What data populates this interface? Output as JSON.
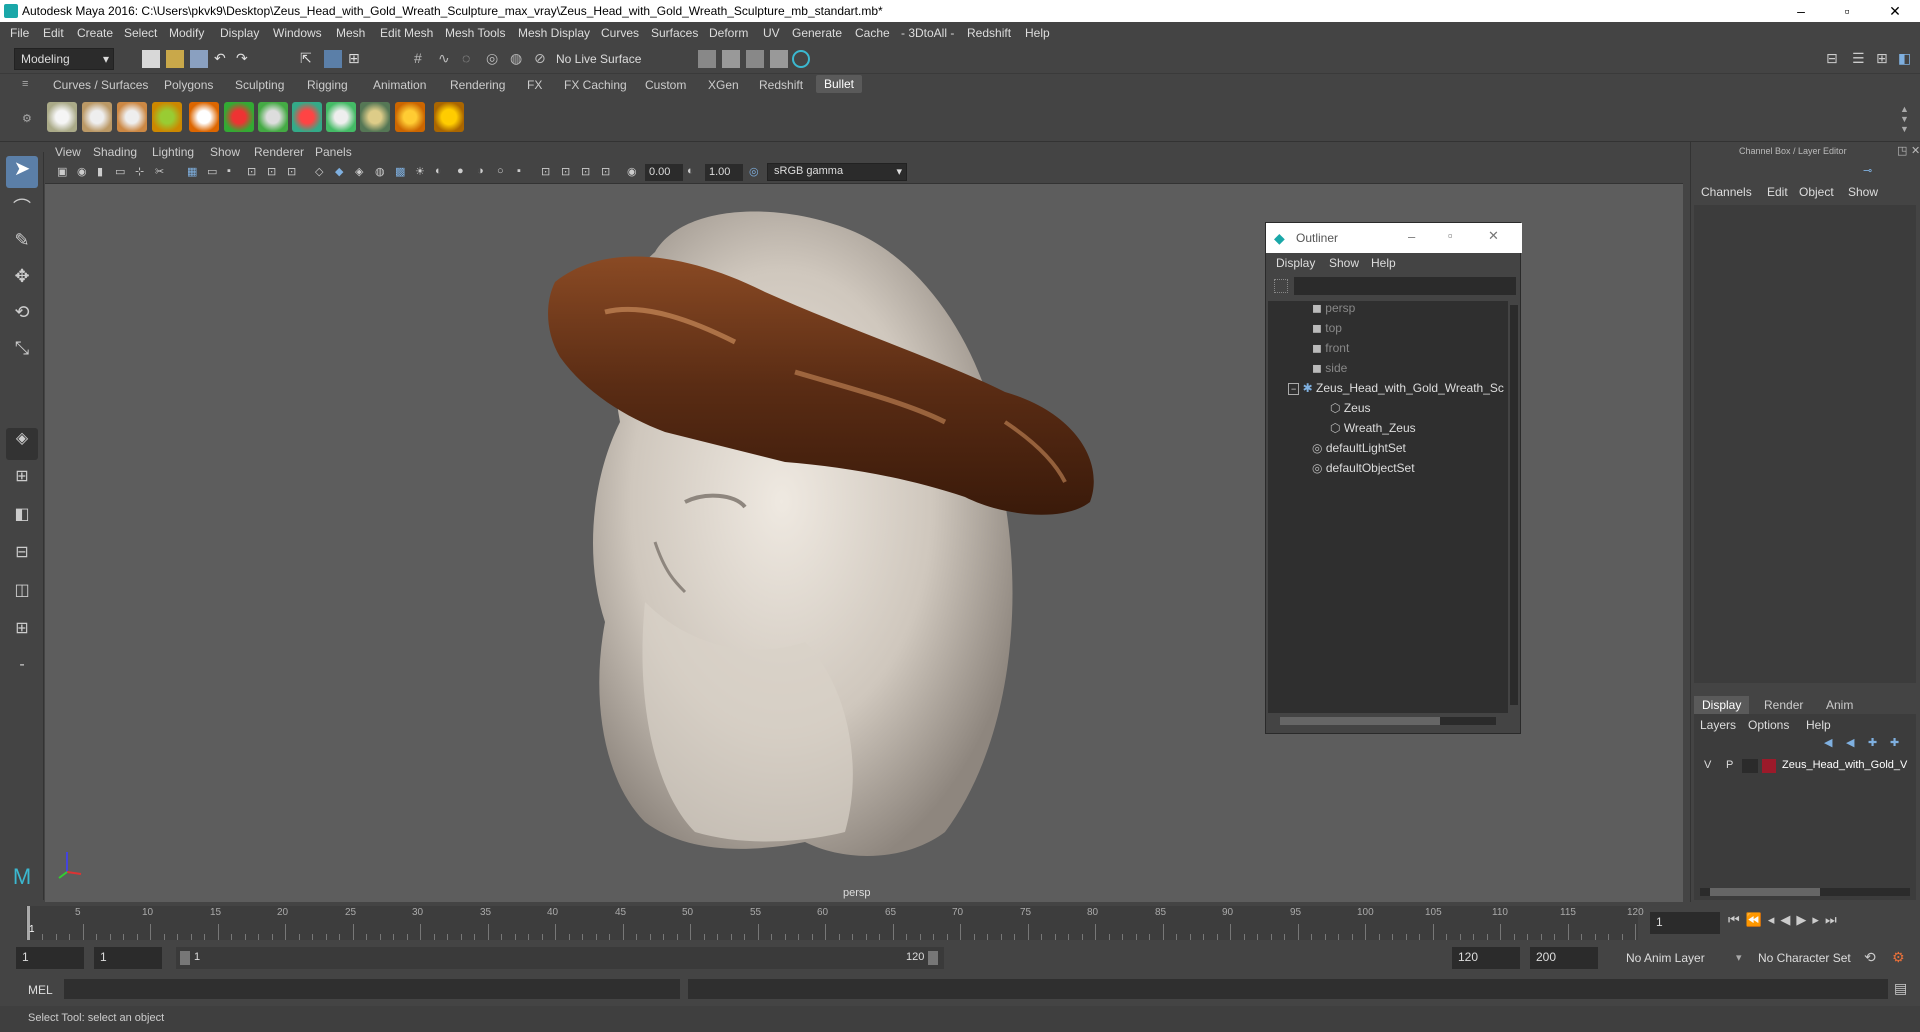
{
  "window": {
    "title": "Autodesk Maya 2016: C:\\Users\\pkvk9\\Desktop\\Zeus_Head_with_Gold_Wreath_Sculpture_max_vray\\Zeus_Head_with_Gold_Wreath_Sculpture_mb_standart.mb*",
    "minimize": "–",
    "maximize": "▫",
    "close": "✕"
  },
  "menubar": [
    "File",
    "Edit",
    "Create",
    "Select",
    "Modify",
    "Display",
    "Windows",
    "Mesh",
    "Edit Mesh",
    "Mesh Tools",
    "Mesh Display",
    "Curves",
    "Surfaces",
    "Deform",
    "UV",
    "Generate",
    "Cache",
    "- 3DtoAll -",
    "Redshift",
    "Help"
  ],
  "statusline": {
    "mode": "Modeling",
    "live_surface": "No Live Surface"
  },
  "shelf_tabs": [
    "Curves / Surfaces",
    "Polygons",
    "Sculpting",
    "Rigging",
    "Animation",
    "Rendering",
    "FX",
    "FX Caching",
    "Custom",
    "XGen",
    "Redshift",
    "Bullet"
  ],
  "active_shelf_tab": "Bullet",
  "viewport": {
    "menu": [
      "View",
      "Shading",
      "Lighting",
      "Show",
      "Renderer",
      "Panels"
    ],
    "exposure": "0.00",
    "gamma": "1.00",
    "color_space": "sRGB gamma",
    "camera_label": "persp"
  },
  "outliner": {
    "title": "Outliner",
    "menu": [
      "Display",
      "Show",
      "Help"
    ],
    "items": [
      {
        "label": "persp",
        "dim": true
      },
      {
        "label": "top",
        "dim": true
      },
      {
        "label": "front",
        "dim": true
      },
      {
        "label": "side",
        "dim": true
      },
      {
        "label": "Zeus_Head_with_Gold_Wreath_Sc",
        "dim": false
      },
      {
        "label": "Zeus",
        "dim": false
      },
      {
        "label": "Wreath_Zeus",
        "dim": false
      },
      {
        "label": "defaultLightSet",
        "dim": false
      },
      {
        "label": "defaultObjectSet",
        "dim": false
      }
    ]
  },
  "channel_box": {
    "header": "Channel Box / Layer Editor",
    "menu": [
      "Channels",
      "Edit",
      "Object",
      "Show"
    ],
    "layer_tabs": [
      "Display",
      "Render",
      "Anim"
    ],
    "layer_menu": [
      "Layers",
      "Options",
      "Help"
    ],
    "layer": {
      "v": "V",
      "p": "P",
      "name": "Zeus_Head_with_Gold_V"
    }
  },
  "timeline": {
    "ticks": [
      "5",
      "10",
      "15",
      "20",
      "25",
      "30",
      "35",
      "40",
      "45",
      "50",
      "55",
      "60",
      "65",
      "70",
      "75",
      "80",
      "85",
      "90",
      "95",
      "100",
      "105",
      "110",
      "115",
      "120"
    ],
    "current_frame_marker": "1",
    "current_frame": "1"
  },
  "range": {
    "start": "1",
    "playback_start": "1",
    "slider_start": "1",
    "slider_end": "120",
    "playback_end": "120",
    "end": "200",
    "anim_layer": "No Anim Layer",
    "character_set": "No Character Set"
  },
  "command_line": {
    "label": "MEL"
  },
  "help_line": "Select Tool: select an object",
  "colors": {
    "wreath": "#5a2c14",
    "head": "#cfc7bd",
    "viewport": "#5d5d5d",
    "layer_color": "#9b1a2a"
  }
}
